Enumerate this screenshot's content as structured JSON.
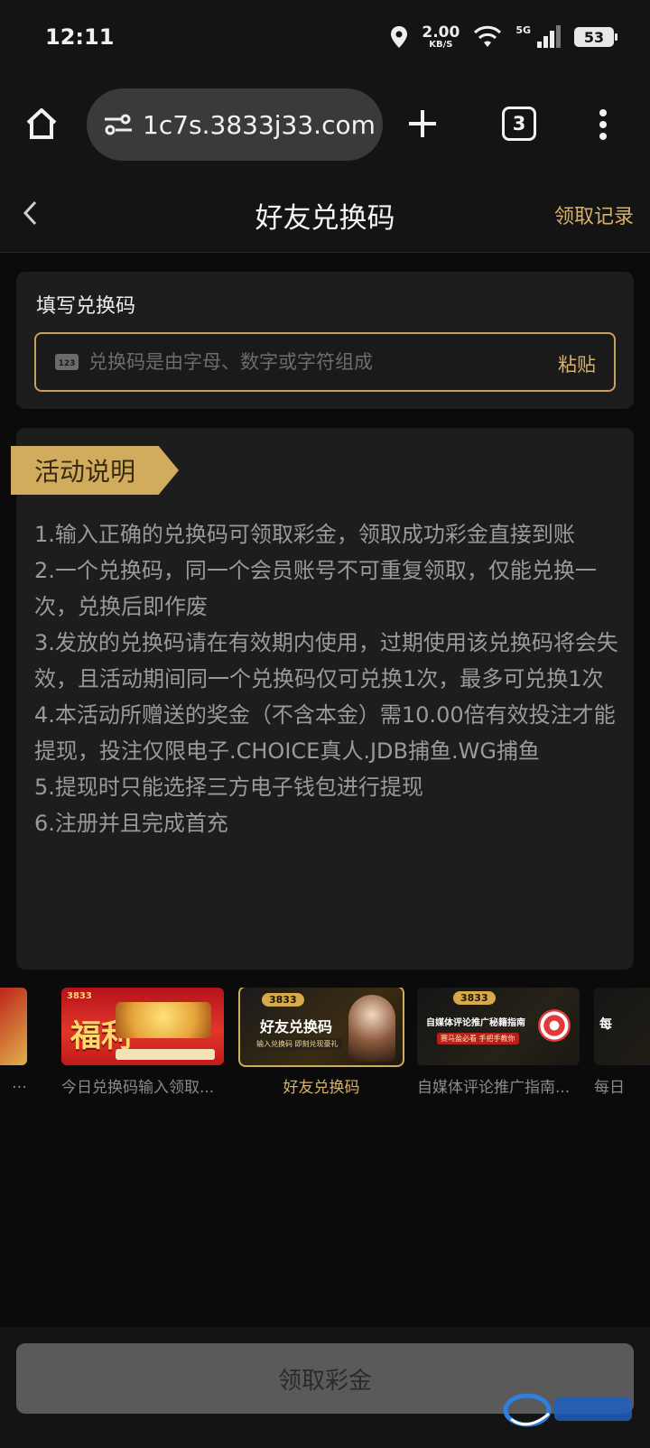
{
  "status_bar": {
    "time": "12:11",
    "speed_value": "2.00",
    "speed_unit": "KB/S",
    "network": "5G",
    "battery": "53"
  },
  "browser": {
    "url": "1c7s.3833j33.com",
    "tab_count": "3"
  },
  "header": {
    "title": "好友兑换码",
    "record_link": "领取记录"
  },
  "code_form": {
    "label": "填写兑换码",
    "placeholder": "兑换码是由字母、数字或字符组成",
    "paste": "粘贴"
  },
  "description": {
    "ribbon": "活动说明",
    "rules": [
      "1.输入正确的兑换码可领取彩金，领取成功彩金直接到账",
      "2.一个兑换码，同一个会员账号不可重复领取，仅能兑换一次，兑换后即作废",
      "3.发放的兑换码请在有效期内使用，过期使用该兑换码将会失效，且活动期间同一个兑换码仅可兑换1次，最多可兑换1次",
      "4.本活动所赠送的奖金（不含本金）需10.00倍有效投注才能提现，投注仅限电子.CHOICE真人.JDB捕鱼.WG捕鱼",
      "5.提现时只能选择三方电子钱包进行提现",
      "6.注册并且完成首充"
    ]
  },
  "promos": [
    {
      "caption": "今日兑换码输入领取...",
      "banner": "福利",
      "brand": "3833"
    },
    {
      "caption": "好友兑换码",
      "banner": "好友兑换码",
      "sub": "输入兑换码 即刻兑现豪礼",
      "brand": "3833"
    },
    {
      "caption": "自媒体评论推广指南...",
      "banner": "自媒体评论推广秘籍指南",
      "sub": "赛马盈必看 手把手教你",
      "brand": "3833"
    },
    {
      "caption": "每日"
    }
  ],
  "footer": {
    "claim_button": "领取彩金"
  },
  "colors": {
    "accent_gold": "#d1ac5c",
    "background": "#0b0b0b",
    "card": "#1d1d1d"
  }
}
